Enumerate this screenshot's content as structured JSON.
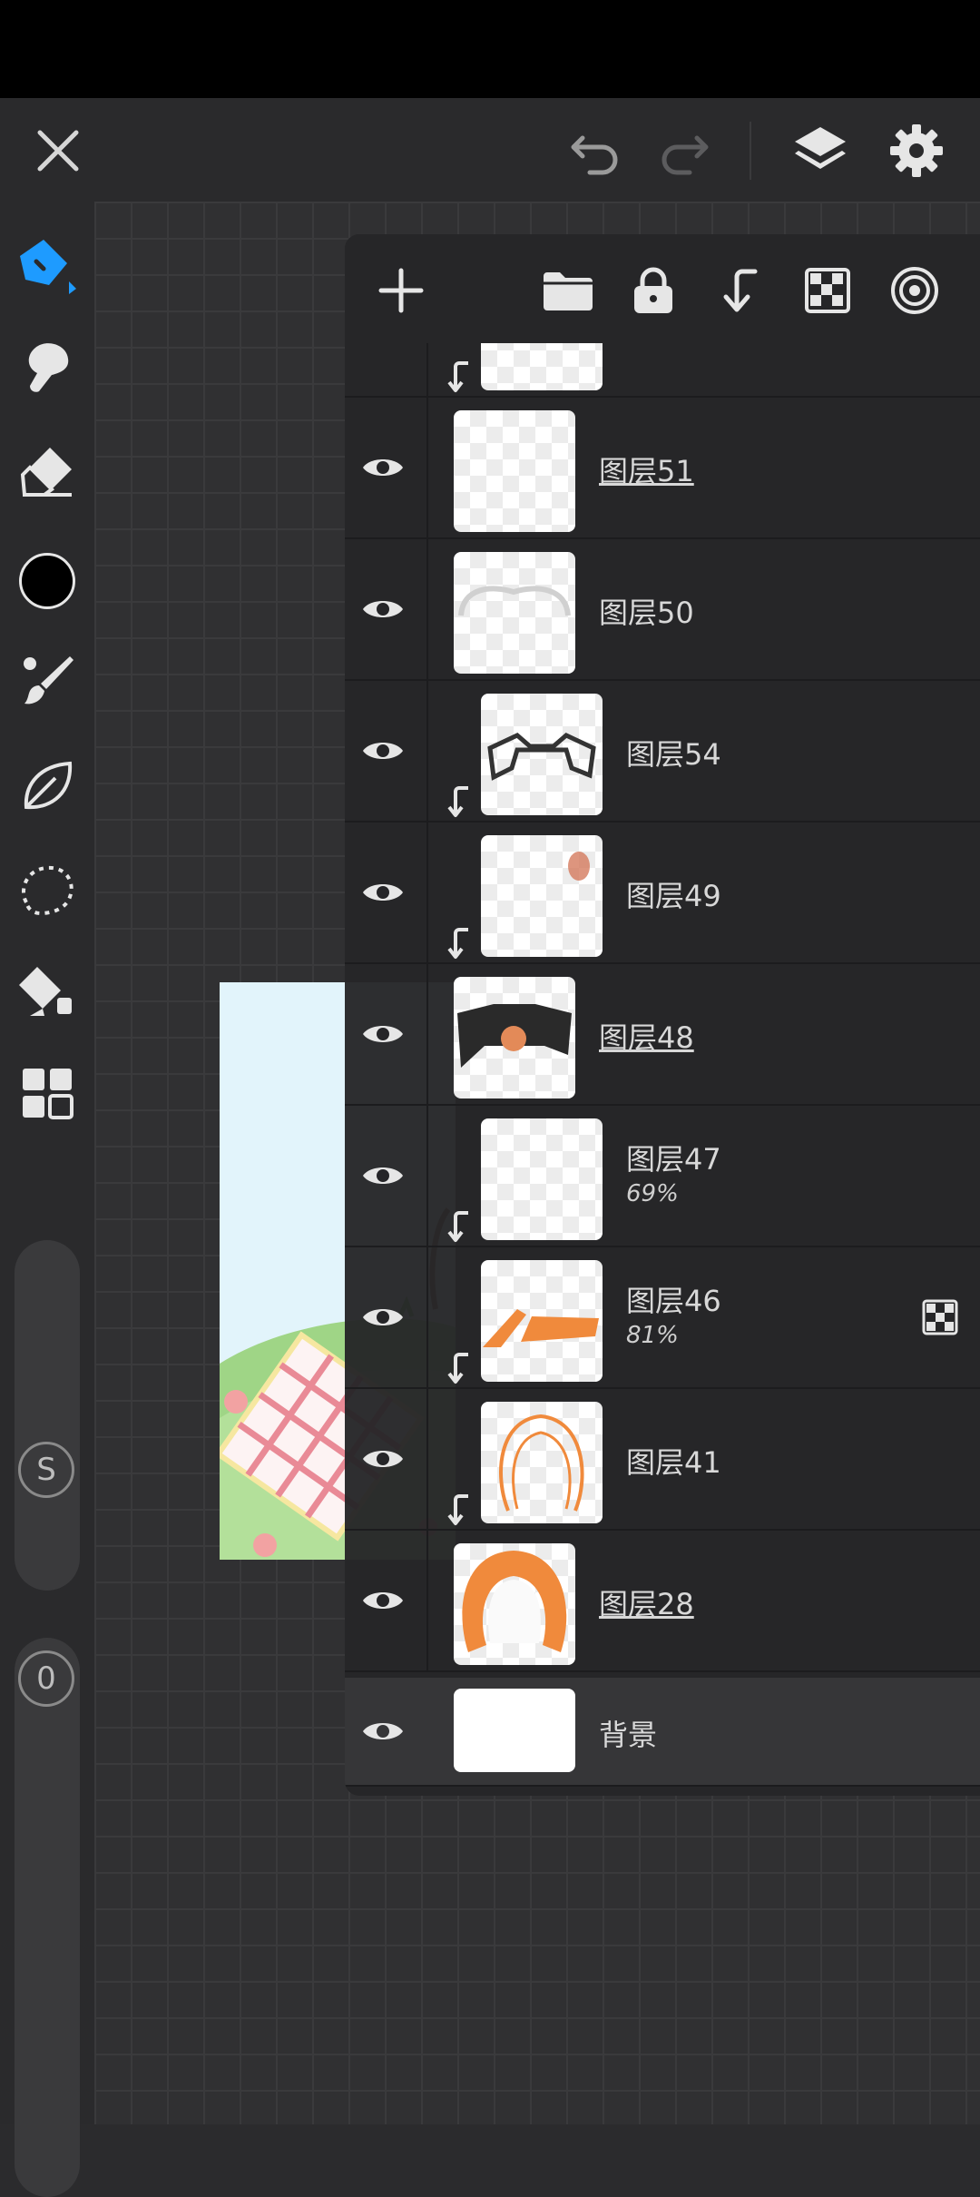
{
  "layers": {
    "items": [
      {
        "name": "图层51",
        "opacity": ""
      },
      {
        "name": "图层50",
        "opacity": ""
      },
      {
        "name": "图层54",
        "opacity": ""
      },
      {
        "name": "图层49",
        "opacity": ""
      },
      {
        "name": "图层48",
        "opacity": ""
      },
      {
        "name": "图层47",
        "opacity": "69%"
      },
      {
        "name": "图层46",
        "opacity": "81%"
      },
      {
        "name": "图层41",
        "opacity": ""
      },
      {
        "name": "图层28",
        "opacity": ""
      },
      {
        "name": "背景",
        "opacity": ""
      }
    ]
  },
  "toolbar": {
    "slider1_label": "S",
    "slider2_label": "0"
  },
  "icons": {
    "close": "close-icon",
    "undo": "undo-icon",
    "redo": "redo-icon",
    "layers": "layers-icon",
    "settings": "gear-icon",
    "add": "plus-icon",
    "folder": "folder-icon",
    "lock": "lock-icon",
    "merge": "merge-down-icon",
    "transparency": "checker-icon",
    "target": "target-icon"
  },
  "colors": {
    "accent": "#1e9bff",
    "brush_color": "#000000",
    "panel_bg": "#252528"
  }
}
